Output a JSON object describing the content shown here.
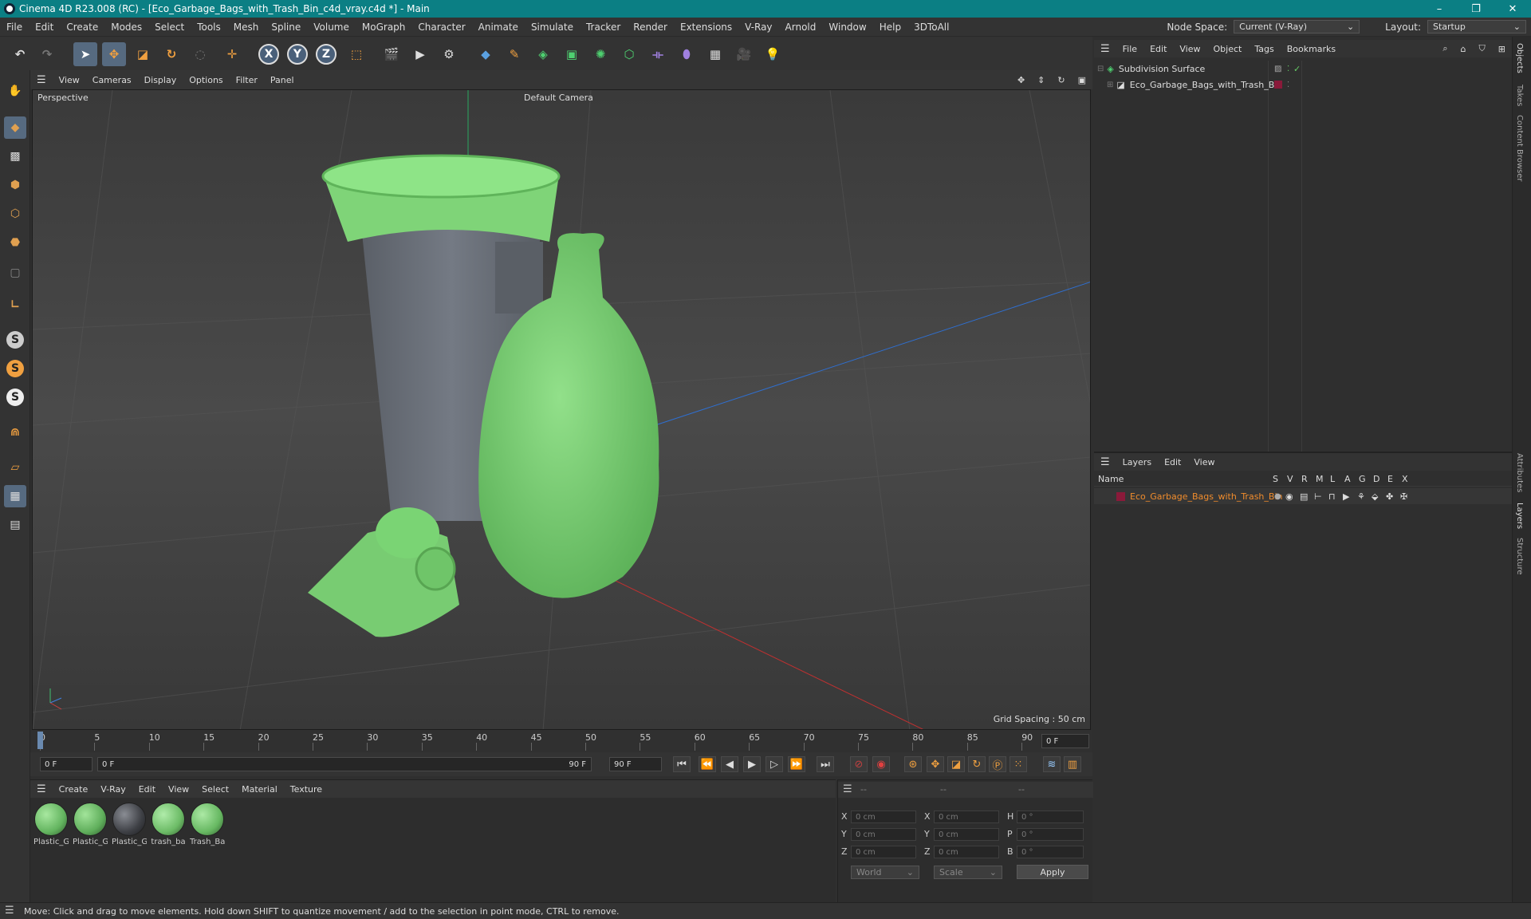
{
  "window": {
    "title": "Cinema 4D R23.008 (RC) - [Eco_Garbage_Bags_with_Trash_Bin_c4d_vray.c4d *] - Main",
    "minimize": "–",
    "restore": "❐",
    "close": "✕"
  },
  "menubar": {
    "items": [
      "File",
      "Edit",
      "Create",
      "Modes",
      "Select",
      "Tools",
      "Mesh",
      "Spline",
      "Volume",
      "MoGraph",
      "Character",
      "Animate",
      "Simulate",
      "Tracker",
      "Render",
      "Extensions",
      "V-Ray",
      "Arnold",
      "Window",
      "Help",
      "3DToAll"
    ],
    "node_space_label": "Node Space:",
    "node_space_value": "Current (V-Ray)",
    "layout_label": "Layout:",
    "layout_value": "Startup"
  },
  "toolbar": {
    "axis_x": "X",
    "axis_y": "Y",
    "axis_z": "Z"
  },
  "lefttools": {
    "s1": "S",
    "s2": "S",
    "s3": "S"
  },
  "viewport": {
    "menu": [
      "View",
      "Cameras",
      "Display",
      "Options",
      "Filter",
      "Panel"
    ],
    "label": "Perspective",
    "camera": "Default Camera",
    "grid_spacing": "Grid Spacing : 50 cm"
  },
  "timeline": {
    "ticks": [
      "0",
      "5",
      "10",
      "15",
      "20",
      "25",
      "30",
      "35",
      "40",
      "45",
      "50",
      "55",
      "60",
      "65",
      "70",
      "75",
      "80",
      "85",
      "90"
    ],
    "current": "0 F"
  },
  "transport": {
    "start": "0 F",
    "range_start": "0 F",
    "range_end": "90 F",
    "end": "90 F"
  },
  "materials": {
    "menu": [
      "Create",
      "V-Ray",
      "Edit",
      "View",
      "Select",
      "Material",
      "Texture"
    ],
    "items": [
      {
        "label": "Plastic_G",
        "color": "#63b45f"
      },
      {
        "label": "Plastic_G",
        "color": "#5fae5b"
      },
      {
        "label": "Plastic_G",
        "color": "#3d3f44"
      },
      {
        "label": "trash_ba",
        "color": "#6cbb66"
      },
      {
        "label": "Trash_Ba",
        "color": "#67b862"
      }
    ]
  },
  "coords": {
    "headers": [
      "--",
      "--",
      "--"
    ],
    "rows": [
      {
        "a": "X",
        "av": "0 cm",
        "b": "X",
        "bv": "0 cm",
        "c": "H",
        "cv": "0 °"
      },
      {
        "a": "Y",
        "av": "0 cm",
        "b": "Y",
        "bv": "0 cm",
        "c": "P",
        "cv": "0 °"
      },
      {
        "a": "Z",
        "av": "0 cm",
        "b": "Z",
        "bv": "0 cm",
        "c": "B",
        "cv": "0 °"
      }
    ],
    "world": "World",
    "scale": "Scale",
    "apply": "Apply"
  },
  "objects": {
    "menu": [
      "File",
      "Edit",
      "View",
      "Object",
      "Tags",
      "Bookmarks"
    ],
    "rows": [
      {
        "name": "Subdivision Surface"
      },
      {
        "name": "Eco_Garbage_Bags_with_Trash_Bin"
      }
    ]
  },
  "layers": {
    "menu": [
      "Layers",
      "Edit",
      "View"
    ],
    "header_name": "Name",
    "columns": [
      "S",
      "V",
      "R",
      "M",
      "L",
      "A",
      "G",
      "D",
      "E",
      "X"
    ],
    "rows": [
      {
        "name": "Eco_Garbage_Bags_with_Trash_Bin",
        "color": "#f08c2c"
      }
    ]
  },
  "sidetabs": [
    "Objects",
    "Takes",
    "Content Browser",
    "Attributes",
    "Layers",
    "Structure"
  ],
  "status": "Move: Click and drag to move elements. Hold down SHIFT to quantize movement / add to the selection in point mode, CTRL to remove.",
  "colors": {
    "accent": "#0b7f84",
    "bag_green": "#7fd478",
    "bin_gray": "#6a6f78",
    "orange": "#f08c2c"
  }
}
